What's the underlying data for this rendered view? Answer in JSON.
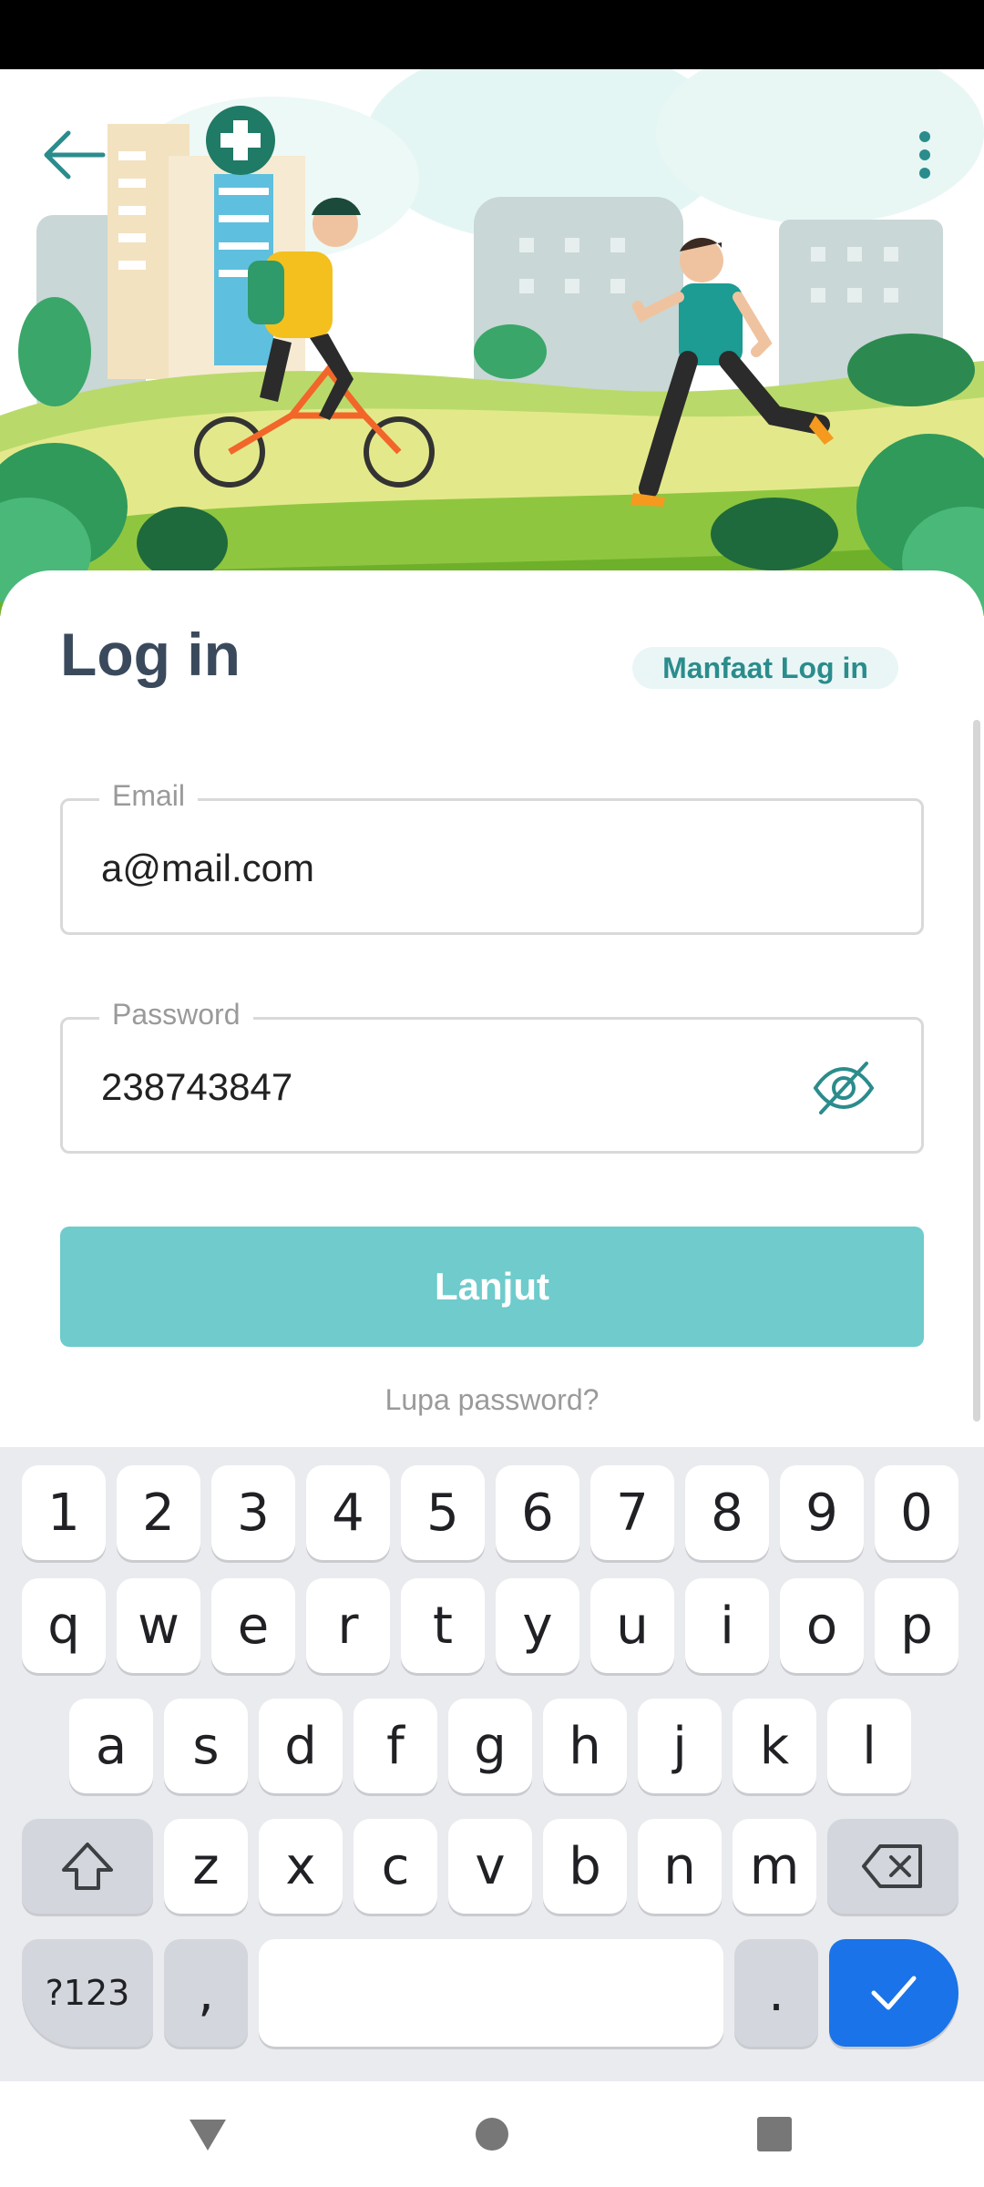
{
  "header": {
    "back_icon": "arrow-left-icon",
    "more_icon": "more-vertical-icon"
  },
  "login": {
    "title": "Log in",
    "benefit_chip": "Manfaat Log in",
    "email": {
      "label": "Email",
      "value": "a@mail.com"
    },
    "password": {
      "label": "Password",
      "value": "238743847",
      "toggle_icon": "eye-off-icon"
    },
    "submit_label": "Lanjut",
    "forgot_label": "Lupa password?"
  },
  "keyboard": {
    "row_numbers": [
      "1",
      "2",
      "3",
      "4",
      "5",
      "6",
      "7",
      "8",
      "9",
      "0"
    ],
    "row_top": [
      "q",
      "w",
      "e",
      "r",
      "t",
      "y",
      "u",
      "i",
      "o",
      "p"
    ],
    "row_middle": [
      "a",
      "s",
      "d",
      "f",
      "g",
      "h",
      "j",
      "k",
      "l"
    ],
    "row_bottom": [
      "z",
      "x",
      "c",
      "v",
      "b",
      "n",
      "m"
    ],
    "symbols_label": "?123",
    "comma_label": ",",
    "period_label": ".",
    "shift_icon": "shift-icon",
    "backspace_icon": "backspace-icon",
    "done_icon": "check-icon"
  },
  "navigation": {
    "back_icon": "nav-back-triangle-icon",
    "home_icon": "nav-home-circle-icon",
    "recents_icon": "nav-recents-square-icon"
  },
  "colors": {
    "accent": "#2b8c8c",
    "button": "#6fcbcc",
    "keyboard_action": "#1a73e8"
  }
}
